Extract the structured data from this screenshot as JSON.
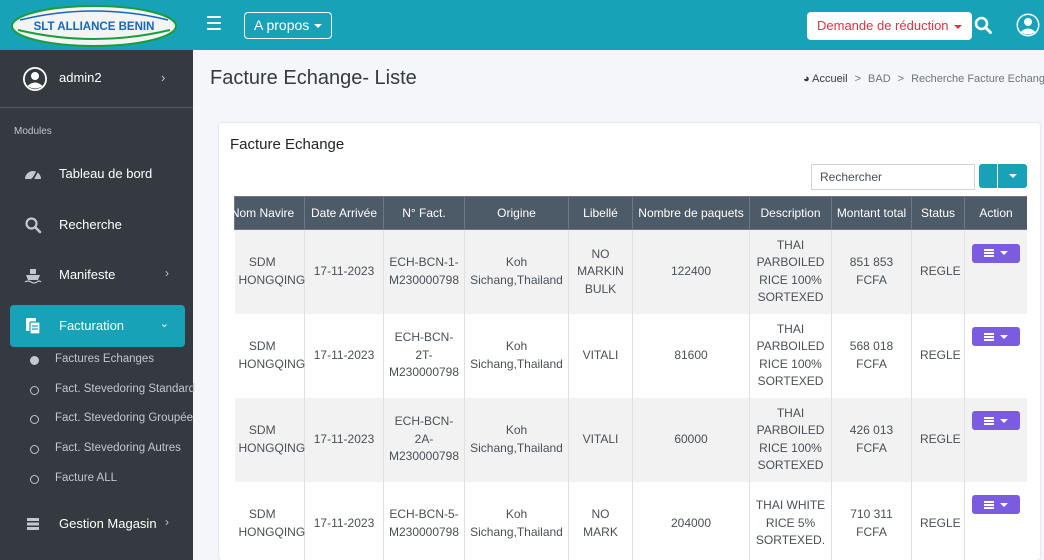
{
  "header": {
    "logo_text": "SLT ALLIANCE BENIN",
    "apropos_label": "A propos",
    "reduction_label": "Demande de réduction",
    "accent_color": "#17a2b8",
    "danger_color": "#dc3545"
  },
  "sidebar": {
    "user_name": "admin2",
    "modules_label": "Modules",
    "items": [
      {
        "label": "Tableau de bord",
        "icon": "dashboard-icon"
      },
      {
        "label": "Recherche",
        "icon": "search-icon"
      },
      {
        "label": "Manifeste",
        "icon": "ship-icon"
      },
      {
        "label": "Facturation",
        "icon": "invoice-icon"
      },
      {
        "label": "Gestion Magasin",
        "icon": "warehouse-icon"
      }
    ],
    "subitems": [
      {
        "label": "Factures Echanges",
        "active": true
      },
      {
        "label": "Fact. Stevedoring Standard",
        "active": false
      },
      {
        "label": "Fact. Stevedoring Groupée",
        "active": false
      },
      {
        "label": "Fact. Stevedoring Autres",
        "active": false
      },
      {
        "label": "Facture ALL",
        "active": false
      }
    ]
  },
  "page": {
    "title": "Facture Echange- Liste",
    "breadcrumb": [
      "Accueil",
      "BAD",
      "Recherche Facture Echange"
    ]
  },
  "card": {
    "title": "Facture Echange",
    "search_placeholder": "Rechercher"
  },
  "table": {
    "columns": [
      "Nom Navire",
      "Date Arrivée",
      "N° Fact.",
      "Origine",
      "Libellé",
      "Nombre de paquets",
      "Description",
      "Montant total",
      "Status",
      "Action"
    ],
    "rows": [
      {
        "navire": "SDM HONGQING",
        "date": "17-11-2023",
        "fact": "ECH-BCN-1-M230000798",
        "origine": "Koh Sichang,Thailand",
        "libelle": "NO MARKIN BULK",
        "paquets": "122400",
        "description": "THAI PARBOILED RICE 100% SORTEXED",
        "montant": "851 853 FCFA",
        "status": "REGLE"
      },
      {
        "navire": "SDM HONGQING",
        "date": "17-11-2023",
        "fact": "ECH-BCN-2T-M230000798",
        "origine": "Koh Sichang,Thailand",
        "libelle": "VITALI",
        "paquets": "81600",
        "description": "THAI PARBOILED RICE 100% SORTEXED",
        "montant": "568 018 FCFA",
        "status": "REGLE"
      },
      {
        "navire": "SDM HONGQING",
        "date": "17-11-2023",
        "fact": "ECH-BCN-2A-M230000798",
        "origine": "Koh Sichang,Thailand",
        "libelle": "VITALI",
        "paquets": "60000",
        "description": "THAI PARBOILED RICE 100% SORTEXED",
        "montant": "426 013 FCFA",
        "status": "REGLE"
      },
      {
        "navire": "SDM HONGQING",
        "date": "17-11-2023",
        "fact": "ECH-BCN-5-M230000798",
        "origine": "Koh Sichang,Thailand",
        "libelle": "NO MARK",
        "paquets": "204000",
        "description": "THAI WHITE RICE 5% SORTEXED.",
        "montant": "710 311 FCFA",
        "status": "REGLE"
      }
    ]
  }
}
